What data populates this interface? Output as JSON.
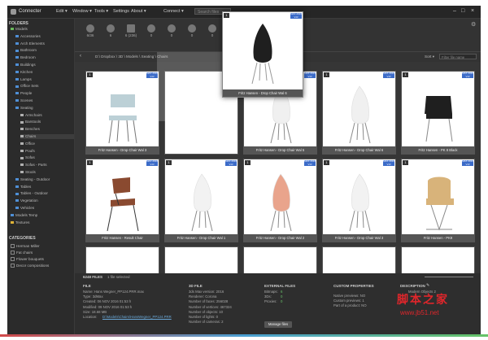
{
  "app": {
    "name": "Connecter"
  },
  "menu": {
    "items": [
      "Edit ▾",
      "Window ▾",
      "Tools ▾",
      "Settings",
      "About ▾"
    ],
    "connect": "Connect ▾",
    "search_placeholder": "Search files"
  },
  "sidebar": {
    "folders_title": "FOLDERS",
    "tree": [
      "Models",
      "Accessories",
      "Arch Elements",
      "Bathroom",
      "Bedroom",
      "Buildings",
      "Kitchen",
      "Lamps",
      "Office Sets",
      "People",
      "Scenes",
      "Seating",
      "Armchairs",
      "Barstools",
      "Benches",
      "Chairs",
      "Office",
      "Poufs",
      "Sofas",
      "Sofas - Parts",
      "Stools",
      "Seating - Outdoor",
      "Tables",
      "Tables - Outdoor",
      "Vegetation",
      "Vehicles",
      "Models Temp",
      "Textures"
    ],
    "categories_title": "CATEGORIES",
    "categories": [
      "Herman Miller",
      "Fat chairs",
      "Flower bouquets",
      "Decor compositions"
    ]
  },
  "toolbar": {
    "counts": [
      "6/36",
      "6",
      "6 (236)",
      "0",
      "0",
      "0",
      "0"
    ]
  },
  "breadcrumb": "D:\\ Dropbox \\ 3D \\ Models \\ Seating \\ Chairs",
  "sort_label": "Sort ▾",
  "filter_placeholder": "Filter file name",
  "badge_text": "MAX 2016 V-R",
  "hover_card": {
    "num": "1",
    "caption": "Fritz Hansen - Drop Chair Wal 6"
  },
  "cards": [
    {
      "num": "1",
      "caption": "Fritz Hansen - Drop Chair Wal 3"
    },
    {
      "num": "",
      "caption": ""
    },
    {
      "num": "1",
      "caption": "Fritz Hansen - Drop Chair Wal 5"
    },
    {
      "num": "1",
      "caption": "Fritz Hansen - Drop Chair Wal 6"
    },
    {
      "num": "1",
      "caption": "Fritz Hansen - PK 8 Black"
    },
    {
      "num": "1",
      "caption": "Fritz Hansen - Result Chair"
    },
    {
      "num": "1",
      "caption": "Fritz Hansen - Drop Chair Wal 1"
    },
    {
      "num": "1",
      "caption": "Fritz Hansen - Drop Chair Wal 2"
    },
    {
      "num": "1",
      "caption": "Fritz Hansen - Drop Chair Wal 3"
    },
    {
      "num": "1",
      "caption": "Fritz Hansen - PK9"
    }
  ],
  "status": {
    "files": "6248 FILES",
    "selected": "1 file selected"
  },
  "details": {
    "file_title": "FILE",
    "file_lines": [
      "Name: Hans Wegner_PP124.PRR.max",
      "Type: 3dMax",
      "Created: 06 NOV 2016 01:53 h",
      "Modified: 09 NOV 2016 01:53 h",
      "Size: 18.68 MB",
      "Location:"
    ],
    "location_link": "D:\\Models\\Chairs\\HansWegner_PP124.PRR",
    "file3d_title": "3D FILE",
    "file3d_lines": [
      "3ds Max version: 2016",
      "Renderer: Corona",
      "Number of faces: 256028",
      "Number of vertices: 467324",
      "Number of objects: 10",
      "Number of lights: 0",
      "Number of cameras: 2"
    ],
    "ext_title": "EXTERNAL FILES",
    "ext_lines": [
      "Bitmaps:",
      "3Ds:",
      "Proxies:"
    ],
    "ext_values": [
      "6",
      "0",
      "0"
    ],
    "manage_label": "Manage files",
    "custom_title": "CUSTOM PROPERTIES",
    "custom_lines": [
      "Native previews: NO",
      "Custom previews: 1",
      "Part of a product: NO"
    ],
    "desc_title": "DESCRIPTION",
    "desc_text": "Modern Objects 2"
  },
  "watermark": {
    "main": "脚本之家",
    "sub": "www.jb51.net"
  }
}
